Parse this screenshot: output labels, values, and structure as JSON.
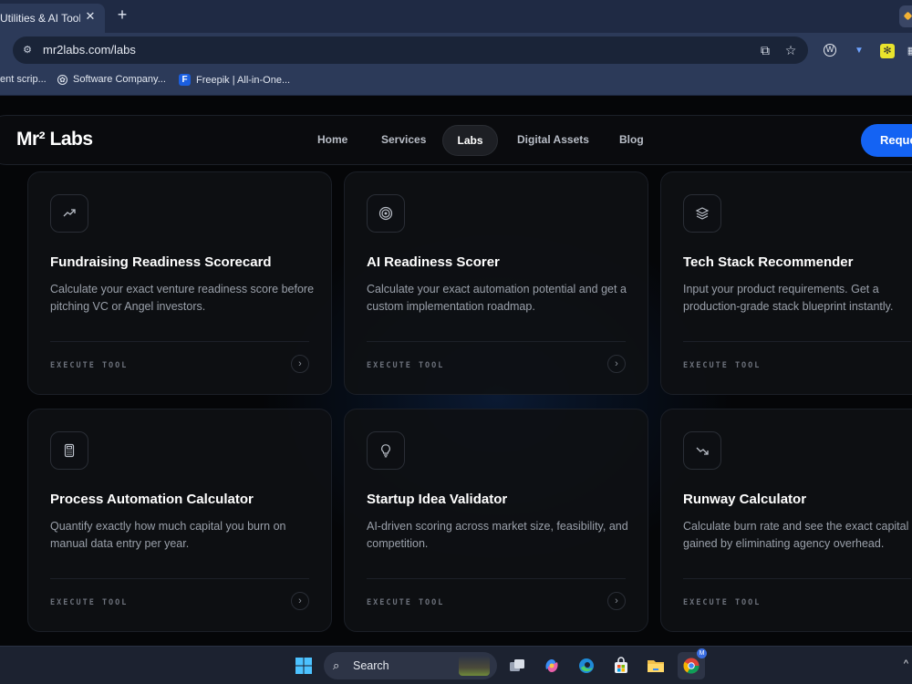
{
  "browser": {
    "tab_title": "Utilities & AI Tools",
    "url": "mr2labs.com/labs",
    "bookmarks": [
      {
        "label": "ent scrip...",
        "icon": "document-icon"
      },
      {
        "label": "Software Company...",
        "icon": "openai-icon"
      },
      {
        "label": "Freepik | All-in-One...",
        "icon": "freepik-icon"
      }
    ]
  },
  "nav": {
    "logo": "Mr² Labs",
    "links": [
      "Home",
      "Services",
      "Labs",
      "Digital Assets",
      "Blog"
    ],
    "active": "Labs",
    "cta": "Request"
  },
  "cards": [
    {
      "title": "Fundraising Readiness Scorecard",
      "desc": "Calculate your exact venture readiness score before pitching VC or Angel investors.",
      "cta": "EXECUTE TOOL",
      "icon": "trending-up-icon"
    },
    {
      "title": "AI Readiness Scorer",
      "desc": "Calculate your exact automation potential and get a custom implementation roadmap.",
      "cta": "EXECUTE TOOL",
      "icon": "target-icon"
    },
    {
      "title": "Tech Stack Recommender",
      "desc": "Input your product requirements. Get a production-grade stack blueprint instantly.",
      "cta": "EXECUTE TOOL",
      "icon": "layers-icon"
    },
    {
      "title": "Process Automation Calculator",
      "desc": "Quantify exactly how much capital you burn on manual data entry per year.",
      "cta": "EXECUTE TOOL",
      "icon": "calculator-icon"
    },
    {
      "title": "Startup Idea Validator",
      "desc": "AI-driven scoring across market size, feasibility, and competition.",
      "cta": "EXECUTE TOOL",
      "icon": "lightbulb-icon"
    },
    {
      "title": "Runway Calculator",
      "desc": "Calculate burn rate and see the exact capital gained by eliminating agency overhead.",
      "cta": "EXECUTE TOOL",
      "icon": "trending-down-icon"
    }
  ],
  "taskbar": {
    "search_label": "Search",
    "apps": [
      "windows-start-icon",
      "task-view-icon",
      "copilot-icon",
      "edge-icon",
      "store-icon",
      "file-explorer-icon",
      "chrome-icon"
    ]
  },
  "colors": {
    "accent": "#1463f3",
    "page_bg": "#050608",
    "card_bg": "#0e1014"
  }
}
